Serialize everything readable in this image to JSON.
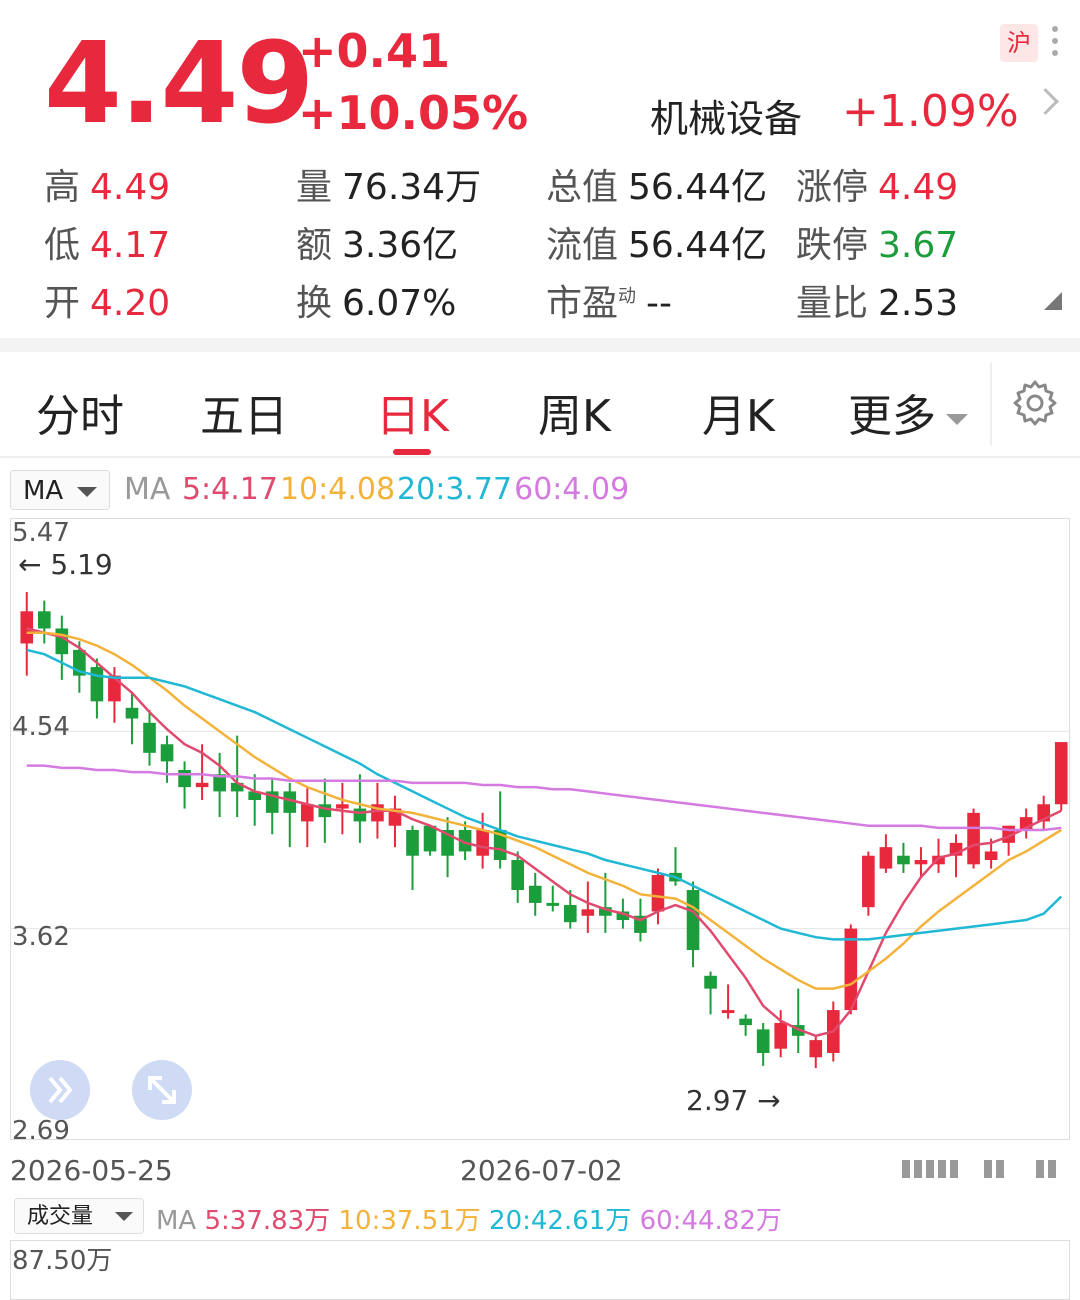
{
  "quote": {
    "price": "4.49",
    "change": "+0.41",
    "change_pct": "+10.05%",
    "sector_name": "机械设备",
    "sector_change": "+1.09%",
    "exchange_badge": "沪"
  },
  "stats": [
    {
      "label": "高",
      "value": "4.49",
      "color": "red"
    },
    {
      "label": "量",
      "value": "76.34万",
      "color": "dark"
    },
    {
      "label": "总值",
      "value": "56.44亿",
      "color": "dark"
    },
    {
      "label": "涨停",
      "value": "4.49",
      "color": "red"
    },
    {
      "label": "低",
      "value": "4.17",
      "color": "red"
    },
    {
      "label": "额",
      "value": "3.36亿",
      "color": "dark"
    },
    {
      "label": "流值",
      "value": "56.44亿",
      "color": "dark"
    },
    {
      "label": "跌停",
      "value": "3.67",
      "color": "green"
    },
    {
      "label": "开",
      "value": "4.20",
      "color": "red"
    },
    {
      "label": "换",
      "value": "6.07%",
      "color": "dark"
    },
    {
      "label": "市盈",
      "sup": "动",
      "value": "--",
      "color": "dark"
    },
    {
      "label": "量比",
      "value": "2.53",
      "color": "dark"
    }
  ],
  "tabs": [
    "分时",
    "五日",
    "日K",
    "周K",
    "月K",
    "更多"
  ],
  "active_tab": "日K",
  "ma_selector": "MA",
  "ma_legend": {
    "prefix": "MA",
    "ma5": "5:4.17",
    "ma10": "10:4.08",
    "ma20": "20:3.77",
    "ma60": "60:4.09"
  },
  "colors": {
    "up": "#e8283c",
    "down": "#1a9d3a",
    "ma5": "#e04a6e",
    "ma10": "#f3b23a",
    "ma20": "#20b8d4",
    "ma60": "#d47ae0"
  },
  "price_axis": {
    "top": "5.47",
    "mid1": "4.54",
    "mid2": "3.62",
    "bottom": "2.69"
  },
  "annotations": {
    "high": "5.19",
    "low": "2.97"
  },
  "dates": {
    "start": "2026-05-25",
    "mid": "2026-07-02"
  },
  "volume": {
    "selector": "成交量",
    "prefix": "MA",
    "ma5": "5:37.83万",
    "ma10": "10:37.51万",
    "ma20": "20:42.61万",
    "ma60": "60:44.82万",
    "axis_top": "87.50万"
  },
  "chart_data": {
    "type": "candlestick",
    "ylim": [
      2.69,
      5.47
    ],
    "y_ticks": [
      5.47,
      4.54,
      3.62,
      2.69
    ],
    "candles": [
      [
        4.95,
        5.1,
        4.8,
        5.19
      ],
      [
        5.1,
        5.02,
        4.95,
        5.15
      ],
      [
        5.02,
        4.9,
        4.78,
        5.08
      ],
      [
        4.92,
        4.8,
        4.72,
        4.96
      ],
      [
        4.84,
        4.68,
        4.6,
        4.88
      ],
      [
        4.68,
        4.8,
        4.58,
        4.84
      ],
      [
        4.65,
        4.6,
        4.48,
        4.72
      ],
      [
        4.58,
        4.44,
        4.38,
        4.64
      ],
      [
        4.48,
        4.4,
        4.3,
        4.52
      ],
      [
        4.36,
        4.28,
        4.18,
        4.4
      ],
      [
        4.28,
        4.3,
        4.22,
        4.48
      ],
      [
        4.34,
        4.26,
        4.14,
        4.44
      ],
      [
        4.3,
        4.26,
        4.14,
        4.52
      ],
      [
        4.26,
        4.22,
        4.1,
        4.34
      ],
      [
        4.26,
        4.16,
        4.06,
        4.32
      ],
      [
        4.26,
        4.16,
        4.0,
        4.3
      ],
      [
        4.12,
        4.2,
        4.0,
        4.28
      ],
      [
        4.2,
        4.14,
        4.02,
        4.32
      ],
      [
        4.18,
        4.2,
        4.06,
        4.3
      ],
      [
        4.18,
        4.12,
        4.02,
        4.34
      ],
      [
        4.12,
        4.2,
        4.04,
        4.3
      ],
      [
        4.1,
        4.18,
        4.0,
        4.24
      ],
      [
        4.08,
        3.96,
        3.8,
        4.1
      ],
      [
        4.1,
        3.98,
        3.96,
        4.1
      ],
      [
        4.08,
        3.96,
        3.86,
        4.14
      ],
      [
        4.08,
        3.98,
        3.94,
        4.12
      ],
      [
        3.96,
        4.08,
        3.9,
        4.16
      ],
      [
        4.08,
        3.94,
        3.9,
        4.26
      ],
      [
        3.94,
        3.8,
        3.74,
        3.98
      ],
      [
        3.82,
        3.74,
        3.68,
        3.88
      ],
      [
        3.74,
        3.73,
        3.7,
        3.82
      ],
      [
        3.73,
        3.65,
        3.62,
        3.8
      ],
      [
        3.68,
        3.71,
        3.6,
        3.84
      ],
      [
        3.72,
        3.68,
        3.6,
        3.88
      ],
      [
        3.7,
        3.66,
        3.62,
        3.76
      ],
      [
        3.68,
        3.6,
        3.56,
        3.76
      ],
      [
        3.7,
        3.87,
        3.64,
        3.9
      ],
      [
        3.88,
        3.84,
        3.82,
        4.0
      ],
      [
        3.8,
        3.52,
        3.44,
        3.84
      ],
      [
        3.4,
        3.34,
        3.22,
        3.42
      ],
      [
        3.24,
        3.24,
        3.2,
        3.36
      ],
      [
        3.2,
        3.17,
        3.12,
        3.22
      ],
      [
        3.15,
        3.04,
        2.98,
        3.18
      ],
      [
        3.06,
        3.18,
        3.02,
        3.24
      ],
      [
        3.17,
        3.12,
        3.04,
        3.34
      ],
      [
        3.02,
        3.1,
        2.97,
        3.12
      ],
      [
        3.04,
        3.24,
        3.0,
        3.28
      ],
      [
        3.24,
        3.62,
        3.22,
        3.64
      ],
      [
        3.72,
        3.96,
        3.68,
        3.98
      ],
      [
        3.9,
        4.0,
        3.88,
        4.06
      ],
      [
        3.96,
        3.92,
        3.88,
        4.02
      ],
      [
        3.92,
        3.94,
        3.86,
        4.0
      ],
      [
        3.92,
        3.96,
        3.88,
        4.04
      ],
      [
        3.96,
        4.02,
        3.86,
        4.06
      ],
      [
        3.92,
        4.16,
        3.9,
        4.18
      ],
      [
        3.94,
        3.98,
        3.9,
        4.04
      ],
      [
        4.02,
        4.1,
        3.96,
        4.1
      ],
      [
        4.08,
        4.14,
        4.04,
        4.18
      ],
      [
        4.12,
        4.2,
        4.08,
        4.24
      ],
      [
        4.2,
        4.49,
        4.17,
        4.49
      ]
    ],
    "series": [
      {
        "name": "MA5",
        "values": [
          5.02,
          5.0,
          4.98,
          4.93,
          4.86,
          4.79,
          4.72,
          4.63,
          4.55,
          4.48,
          4.44,
          4.38,
          4.3,
          4.26,
          4.24,
          4.22,
          4.2,
          4.18,
          4.17,
          4.16,
          4.17,
          4.17,
          4.13,
          4.1,
          4.06,
          4.02,
          4.0,
          3.99,
          3.96,
          3.9,
          3.84,
          3.78,
          3.74,
          3.71,
          3.69,
          3.66,
          3.7,
          3.73,
          3.7,
          3.61,
          3.5,
          3.39,
          3.26,
          3.19,
          3.15,
          3.12,
          3.14,
          3.24,
          3.42,
          3.6,
          3.74,
          3.86,
          3.95,
          3.97,
          4.01,
          4.02,
          4.05,
          4.09,
          4.13,
          4.17
        ]
      },
      {
        "name": "MA10",
        "values": [
          5.0,
          5.0,
          4.99,
          4.97,
          4.94,
          4.9,
          4.85,
          4.79,
          4.73,
          4.66,
          4.6,
          4.54,
          4.48,
          4.42,
          4.37,
          4.32,
          4.28,
          4.25,
          4.22,
          4.2,
          4.18,
          4.17,
          4.16,
          4.14,
          4.12,
          4.1,
          4.08,
          4.06,
          4.03,
          4.0,
          3.96,
          3.92,
          3.88,
          3.85,
          3.82,
          3.78,
          3.77,
          3.76,
          3.72,
          3.66,
          3.6,
          3.54,
          3.48,
          3.43,
          3.38,
          3.34,
          3.34,
          3.36,
          3.42,
          3.48,
          3.55,
          3.63,
          3.7,
          3.76,
          3.82,
          3.88,
          3.94,
          3.98,
          4.03,
          4.08
        ]
      },
      {
        "name": "MA20",
        "values": [
          4.92,
          4.9,
          4.86,
          4.82,
          4.8,
          4.79,
          4.79,
          4.79,
          4.77,
          4.75,
          4.72,
          4.69,
          4.66,
          4.63,
          4.59,
          4.55,
          4.51,
          4.47,
          4.43,
          4.39,
          4.34,
          4.3,
          4.26,
          4.22,
          4.18,
          4.14,
          4.11,
          4.08,
          4.05,
          4.03,
          4.01,
          3.99,
          3.97,
          3.94,
          3.92,
          3.9,
          3.88,
          3.86,
          3.82,
          3.78,
          3.74,
          3.7,
          3.66,
          3.62,
          3.6,
          3.58,
          3.57,
          3.57,
          3.57,
          3.58,
          3.59,
          3.6,
          3.61,
          3.62,
          3.63,
          3.64,
          3.65,
          3.66,
          3.69,
          3.77
        ]
      },
      {
        "name": "MA60",
        "values": [
          4.38,
          4.38,
          4.37,
          4.37,
          4.36,
          4.36,
          4.35,
          4.35,
          4.34,
          4.34,
          4.34,
          4.33,
          4.33,
          4.32,
          4.32,
          4.31,
          4.31,
          4.31,
          4.31,
          4.31,
          4.31,
          4.31,
          4.3,
          4.3,
          4.3,
          4.3,
          4.29,
          4.29,
          4.28,
          4.28,
          4.27,
          4.27,
          4.26,
          4.25,
          4.24,
          4.23,
          4.22,
          4.21,
          4.2,
          4.19,
          4.18,
          4.17,
          4.16,
          4.15,
          4.14,
          4.13,
          4.12,
          4.11,
          4.1,
          4.1,
          4.1,
          4.1,
          4.09,
          4.09,
          4.09,
          4.09,
          4.08,
          4.08,
          4.08,
          4.09
        ]
      }
    ]
  }
}
